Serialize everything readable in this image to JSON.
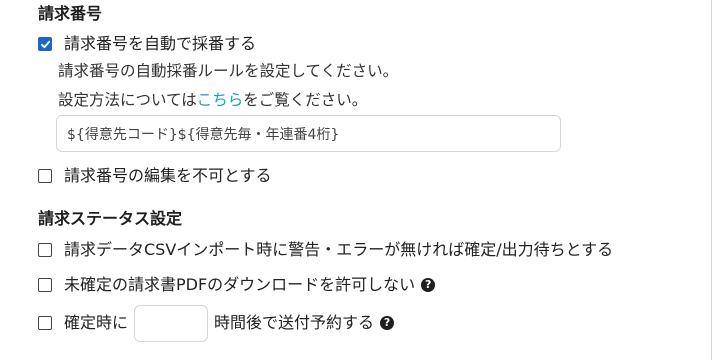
{
  "invoice_number": {
    "section_title": "請求番号",
    "auto_number_checkbox": {
      "label": "請求番号を自動で採番する",
      "checked": true
    },
    "description_line1": "請求番号の自動採番ルールを設定してください。",
    "description_line2_prefix": "設定方法については",
    "description_line2_link": "こちら",
    "description_line2_suffix": "をご覧ください。",
    "format_input_value": "${得意先コード}${得意先毎・年連番4桁}",
    "disable_edit_checkbox": {
      "label": "請求番号の編集を不可とする",
      "checked": false
    }
  },
  "status_settings": {
    "section_title": "請求ステータス設定",
    "csv_import_checkbox": {
      "label": "請求データCSVインポート時に警告・エラーが無ければ確定/出力待ちとする",
      "checked": false
    },
    "no_pdf_download_checkbox": {
      "label": "未確定の請求書PDFのダウンロードを許可しない",
      "checked": false
    },
    "scheduled_send_checkbox": {
      "label_prefix": "確定時に",
      "hours_value": "",
      "label_suffix": "時間後で送付予約する",
      "checked": false
    }
  },
  "icons": {
    "help": "?",
    "checkmark": "check-icon"
  },
  "colors": {
    "checkbox_checked": "#1a66c9",
    "link": "#1aa3b5",
    "input_border": "#d6d6d6"
  }
}
